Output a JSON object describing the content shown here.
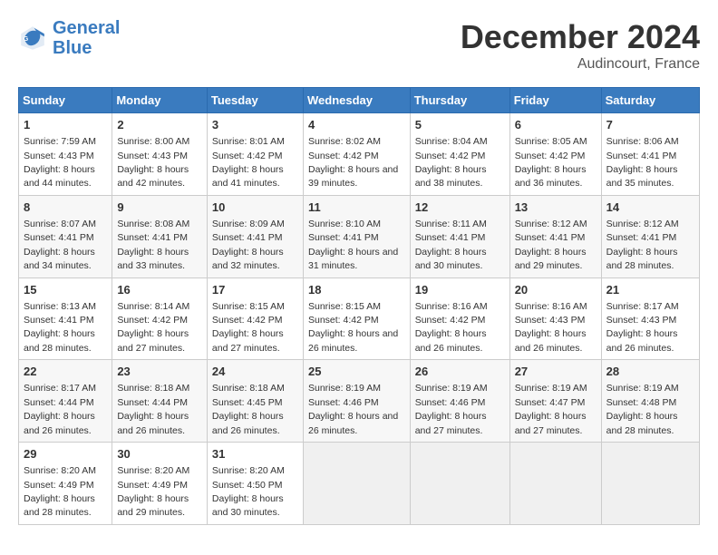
{
  "header": {
    "logo_line1": "General",
    "logo_line2": "Blue",
    "month_year": "December 2024",
    "location": "Audincourt, France"
  },
  "days_of_week": [
    "Sunday",
    "Monday",
    "Tuesday",
    "Wednesday",
    "Thursday",
    "Friday",
    "Saturday"
  ],
  "weeks": [
    [
      {
        "day": 1,
        "sunrise": "7:59 AM",
        "sunset": "4:43 PM",
        "daylight": "8 hours and 44 minutes."
      },
      {
        "day": 2,
        "sunrise": "8:00 AM",
        "sunset": "4:43 PM",
        "daylight": "8 hours and 42 minutes."
      },
      {
        "day": 3,
        "sunrise": "8:01 AM",
        "sunset": "4:42 PM",
        "daylight": "8 hours and 41 minutes."
      },
      {
        "day": 4,
        "sunrise": "8:02 AM",
        "sunset": "4:42 PM",
        "daylight": "8 hours and 39 minutes."
      },
      {
        "day": 5,
        "sunrise": "8:04 AM",
        "sunset": "4:42 PM",
        "daylight": "8 hours and 38 minutes."
      },
      {
        "day": 6,
        "sunrise": "8:05 AM",
        "sunset": "4:42 PM",
        "daylight": "8 hours and 36 minutes."
      },
      {
        "day": 7,
        "sunrise": "8:06 AM",
        "sunset": "4:41 PM",
        "daylight": "8 hours and 35 minutes."
      }
    ],
    [
      {
        "day": 8,
        "sunrise": "8:07 AM",
        "sunset": "4:41 PM",
        "daylight": "8 hours and 34 minutes."
      },
      {
        "day": 9,
        "sunrise": "8:08 AM",
        "sunset": "4:41 PM",
        "daylight": "8 hours and 33 minutes."
      },
      {
        "day": 10,
        "sunrise": "8:09 AM",
        "sunset": "4:41 PM",
        "daylight": "8 hours and 32 minutes."
      },
      {
        "day": 11,
        "sunrise": "8:10 AM",
        "sunset": "4:41 PM",
        "daylight": "8 hours and 31 minutes."
      },
      {
        "day": 12,
        "sunrise": "8:11 AM",
        "sunset": "4:41 PM",
        "daylight": "8 hours and 30 minutes."
      },
      {
        "day": 13,
        "sunrise": "8:12 AM",
        "sunset": "4:41 PM",
        "daylight": "8 hours and 29 minutes."
      },
      {
        "day": 14,
        "sunrise": "8:12 AM",
        "sunset": "4:41 PM",
        "daylight": "8 hours and 28 minutes."
      }
    ],
    [
      {
        "day": 15,
        "sunrise": "8:13 AM",
        "sunset": "4:41 PM",
        "daylight": "8 hours and 28 minutes."
      },
      {
        "day": 16,
        "sunrise": "8:14 AM",
        "sunset": "4:42 PM",
        "daylight": "8 hours and 27 minutes."
      },
      {
        "day": 17,
        "sunrise": "8:15 AM",
        "sunset": "4:42 PM",
        "daylight": "8 hours and 27 minutes."
      },
      {
        "day": 18,
        "sunrise": "8:15 AM",
        "sunset": "4:42 PM",
        "daylight": "8 hours and 26 minutes."
      },
      {
        "day": 19,
        "sunrise": "8:16 AM",
        "sunset": "4:42 PM",
        "daylight": "8 hours and 26 minutes."
      },
      {
        "day": 20,
        "sunrise": "8:16 AM",
        "sunset": "4:43 PM",
        "daylight": "8 hours and 26 minutes."
      },
      {
        "day": 21,
        "sunrise": "8:17 AM",
        "sunset": "4:43 PM",
        "daylight": "8 hours and 26 minutes."
      }
    ],
    [
      {
        "day": 22,
        "sunrise": "8:17 AM",
        "sunset": "4:44 PM",
        "daylight": "8 hours and 26 minutes."
      },
      {
        "day": 23,
        "sunrise": "8:18 AM",
        "sunset": "4:44 PM",
        "daylight": "8 hours and 26 minutes."
      },
      {
        "day": 24,
        "sunrise": "8:18 AM",
        "sunset": "4:45 PM",
        "daylight": "8 hours and 26 minutes."
      },
      {
        "day": 25,
        "sunrise": "8:19 AM",
        "sunset": "4:46 PM",
        "daylight": "8 hours and 26 minutes."
      },
      {
        "day": 26,
        "sunrise": "8:19 AM",
        "sunset": "4:46 PM",
        "daylight": "8 hours and 27 minutes."
      },
      {
        "day": 27,
        "sunrise": "8:19 AM",
        "sunset": "4:47 PM",
        "daylight": "8 hours and 27 minutes."
      },
      {
        "day": 28,
        "sunrise": "8:19 AM",
        "sunset": "4:48 PM",
        "daylight": "8 hours and 28 minutes."
      }
    ],
    [
      {
        "day": 29,
        "sunrise": "8:20 AM",
        "sunset": "4:49 PM",
        "daylight": "8 hours and 28 minutes."
      },
      {
        "day": 30,
        "sunrise": "8:20 AM",
        "sunset": "4:49 PM",
        "daylight": "8 hours and 29 minutes."
      },
      {
        "day": 31,
        "sunrise": "8:20 AM",
        "sunset": "4:50 PM",
        "daylight": "8 hours and 30 minutes."
      },
      null,
      null,
      null,
      null
    ]
  ]
}
